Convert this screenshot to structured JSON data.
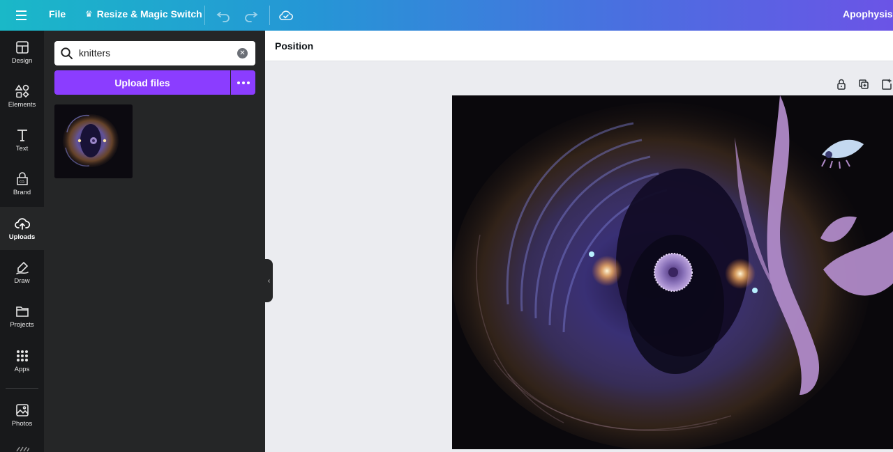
{
  "topbar": {
    "file_label": "File",
    "resize_label": "Resize & Magic Switch",
    "doc_title": "Apophysis-I"
  },
  "rail": {
    "items": [
      {
        "label": "Design",
        "icon": "design-icon"
      },
      {
        "label": "Elements",
        "icon": "elements-icon"
      },
      {
        "label": "Text",
        "icon": "text-icon"
      },
      {
        "label": "Brand",
        "icon": "brand-icon"
      },
      {
        "label": "Uploads",
        "icon": "uploads-icon",
        "active": true
      },
      {
        "label": "Draw",
        "icon": "draw-icon"
      },
      {
        "label": "Projects",
        "icon": "projects-icon"
      },
      {
        "label": "Apps",
        "icon": "apps-icon"
      },
      {
        "label": "Photos",
        "icon": "photos-icon"
      }
    ]
  },
  "panel": {
    "search": {
      "value": "knitters"
    },
    "upload_label": "Upload files"
  },
  "context_bar": {
    "position_label": "Position"
  },
  "colors": {
    "accent": "#8b3dff",
    "rail_bg": "#18191b",
    "panel_bg": "#252627",
    "canvas_bg": "#ebecf0",
    "figure_purple": "#b08ac8"
  }
}
